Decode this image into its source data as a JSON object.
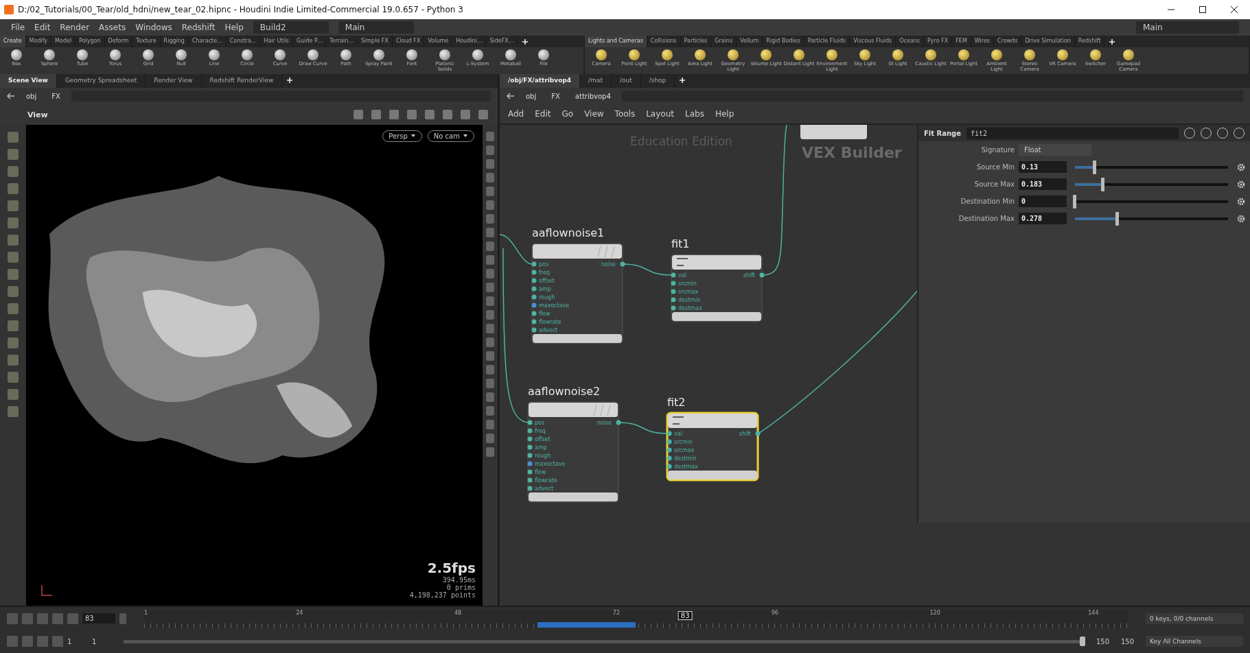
{
  "window": {
    "title": "D:/02_Tutorials/00_Tear/old_hdni/new_tear_02.hipnc - Houdini Indie Limited-Commercial 19.0.657 - Python 3"
  },
  "menu": [
    "File",
    "Edit",
    "Render",
    "Assets",
    "Windows",
    "Redshift",
    "Help"
  ],
  "desktops": [
    "Build2",
    "Main"
  ],
  "shelf_left": {
    "tabs": [
      {
        "label": "Create",
        "selected": true
      },
      {
        "label": "Modify",
        "selected": false
      },
      {
        "label": "Model",
        "selected": false
      },
      {
        "label": "Polygon",
        "selected": false
      },
      {
        "label": "Deform",
        "selected": false
      },
      {
        "label": "Texture",
        "selected": false
      },
      {
        "label": "Rigging",
        "selected": false
      },
      {
        "label": "Characte...",
        "selected": false
      },
      {
        "label": "Constra...",
        "selected": false
      },
      {
        "label": "Hair Utils",
        "selected": false
      },
      {
        "label": "Guide P...",
        "selected": false
      },
      {
        "label": "Terrain...",
        "selected": false
      },
      {
        "label": "Simple FX",
        "selected": false
      },
      {
        "label": "Cloud FX",
        "selected": false
      },
      {
        "label": "Volume",
        "selected": false
      },
      {
        "label": "Houdini...",
        "selected": false
      },
      {
        "label": "SideFX...",
        "selected": false
      }
    ],
    "tools": [
      "Box",
      "Sphere",
      "Tube",
      "Torus",
      "Grid",
      "Null",
      "Line",
      "Circle",
      "Curve",
      "Draw Curve",
      "Path",
      "Spray Paint",
      "Font",
      "Platonic Solids",
      "L-System",
      "Metaball",
      "File"
    ]
  },
  "shelf_right": {
    "desktop": "Main",
    "tabs": [
      {
        "label": "Lights and Cameras",
        "selected": true
      },
      {
        "label": "Collisions",
        "selected": false
      },
      {
        "label": "Particles",
        "selected": false
      },
      {
        "label": "Grains",
        "selected": false
      },
      {
        "label": "Vellum",
        "selected": false
      },
      {
        "label": "Rigid Bodies",
        "selected": false
      },
      {
        "label": "Particle Fluids",
        "selected": false
      },
      {
        "label": "Viscous Fluids",
        "selected": false
      },
      {
        "label": "Oceans",
        "selected": false
      },
      {
        "label": "Pyro FX",
        "selected": false
      },
      {
        "label": "FEM",
        "selected": false
      },
      {
        "label": "Wires",
        "selected": false
      },
      {
        "label": "Crowds",
        "selected": false
      },
      {
        "label": "Drive Simulation",
        "selected": false
      },
      {
        "label": "Redshift",
        "selected": false
      }
    ],
    "tools": [
      "Camera",
      "Point Light",
      "Spot Light",
      "Area Light",
      "Geometry Light",
      "Volume Light",
      "Distant Light",
      "Environment Light",
      "Sky Light",
      "GI Light",
      "Caustic Light",
      "Portal Light",
      "Ambient Light",
      "Stereo Camera",
      "VR Camera",
      "Switcher",
      "Gamepad Camera"
    ]
  },
  "left_pane": {
    "tabs": [
      {
        "label": "Scene View",
        "selected": true
      },
      {
        "label": "Geometry Spreadsheet",
        "selected": false
      },
      {
        "label": "Render View",
        "selected": false
      },
      {
        "label": "Redshift RenderView",
        "selected": false
      }
    ],
    "path": [
      "obj",
      "FX"
    ],
    "viewport": {
      "title": "View",
      "camera_menus": [
        "Persp",
        "No cam"
      ],
      "fps": "2.5fps",
      "time": "394.95ms",
      "stats": [
        "0  prims",
        "4,198,237 points"
      ]
    }
  },
  "right_pane": {
    "tabs": [
      {
        "label": "/obj/FX/attribvop4",
        "selected": true
      },
      {
        "label": "/mat",
        "selected": false
      },
      {
        "label": "/out",
        "selected": false
      },
      {
        "label": "/shop",
        "selected": false
      }
    ],
    "path": [
      "obj",
      "FX",
      "attribvop4"
    ],
    "menu": [
      "Add",
      "Edit",
      "Go",
      "View",
      "Tools",
      "Layout",
      "Labs",
      "Help"
    ],
    "background_labels": [
      "Education Edition",
      "VEX Builder"
    ],
    "nodes": [
      {
        "name": "aaflownoise1",
        "kind": "noise",
        "selected": false,
        "inputs": [
          "pos",
          "freq",
          "offset",
          "amp",
          "rough",
          "maxoctave",
          "flow",
          "flowrate",
          "advect"
        ],
        "outputs": [
          "noise"
        ]
      },
      {
        "name": "fit1",
        "kind": "fit",
        "selected": false,
        "inputs": [
          "val",
          "srcmin",
          "srcmax",
          "destmin",
          "destmax"
        ],
        "outputs": [
          "shift"
        ]
      },
      {
        "name": "aaflownoise2",
        "kind": "noise",
        "selected": false,
        "inputs": [
          "pos",
          "freq",
          "offset",
          "amp",
          "rough",
          "maxoctave",
          "flow",
          "flowrate",
          "advect"
        ],
        "outputs": [
          "noise"
        ]
      },
      {
        "name": "fit2",
        "kind": "fit",
        "selected": true,
        "inputs": [
          "val",
          "srcmin",
          "srcmax",
          "destmin",
          "destmax"
        ],
        "outputs": [
          "shift"
        ]
      }
    ]
  },
  "parameters": {
    "type": "Fit Range",
    "name": "fit2",
    "signature": {
      "label": "Signature",
      "value": "Float"
    },
    "rows": [
      {
        "label": "Source Min",
        "value": "0.13",
        "level": 0.13
      },
      {
        "label": "Source Max",
        "value": "0.183",
        "level": 0.183
      },
      {
        "label": "Destination Min",
        "value": "0",
        "level": 0
      },
      {
        "label": "Destination Max",
        "value": "0.278",
        "level": 0.278
      }
    ]
  },
  "timeline": {
    "frame": "83",
    "ticks": [
      "1",
      "24",
      "48",
      "72",
      "96",
      "120",
      "144"
    ],
    "playhead": {
      "label": "83",
      "level": 0.55
    },
    "range": [
      "1",
      "1",
      "150",
      "150"
    ],
    "range_slider": {
      "level": 1
    },
    "keys": "0 keys, 0/0 channels",
    "key_all": "Key All Channels"
  }
}
